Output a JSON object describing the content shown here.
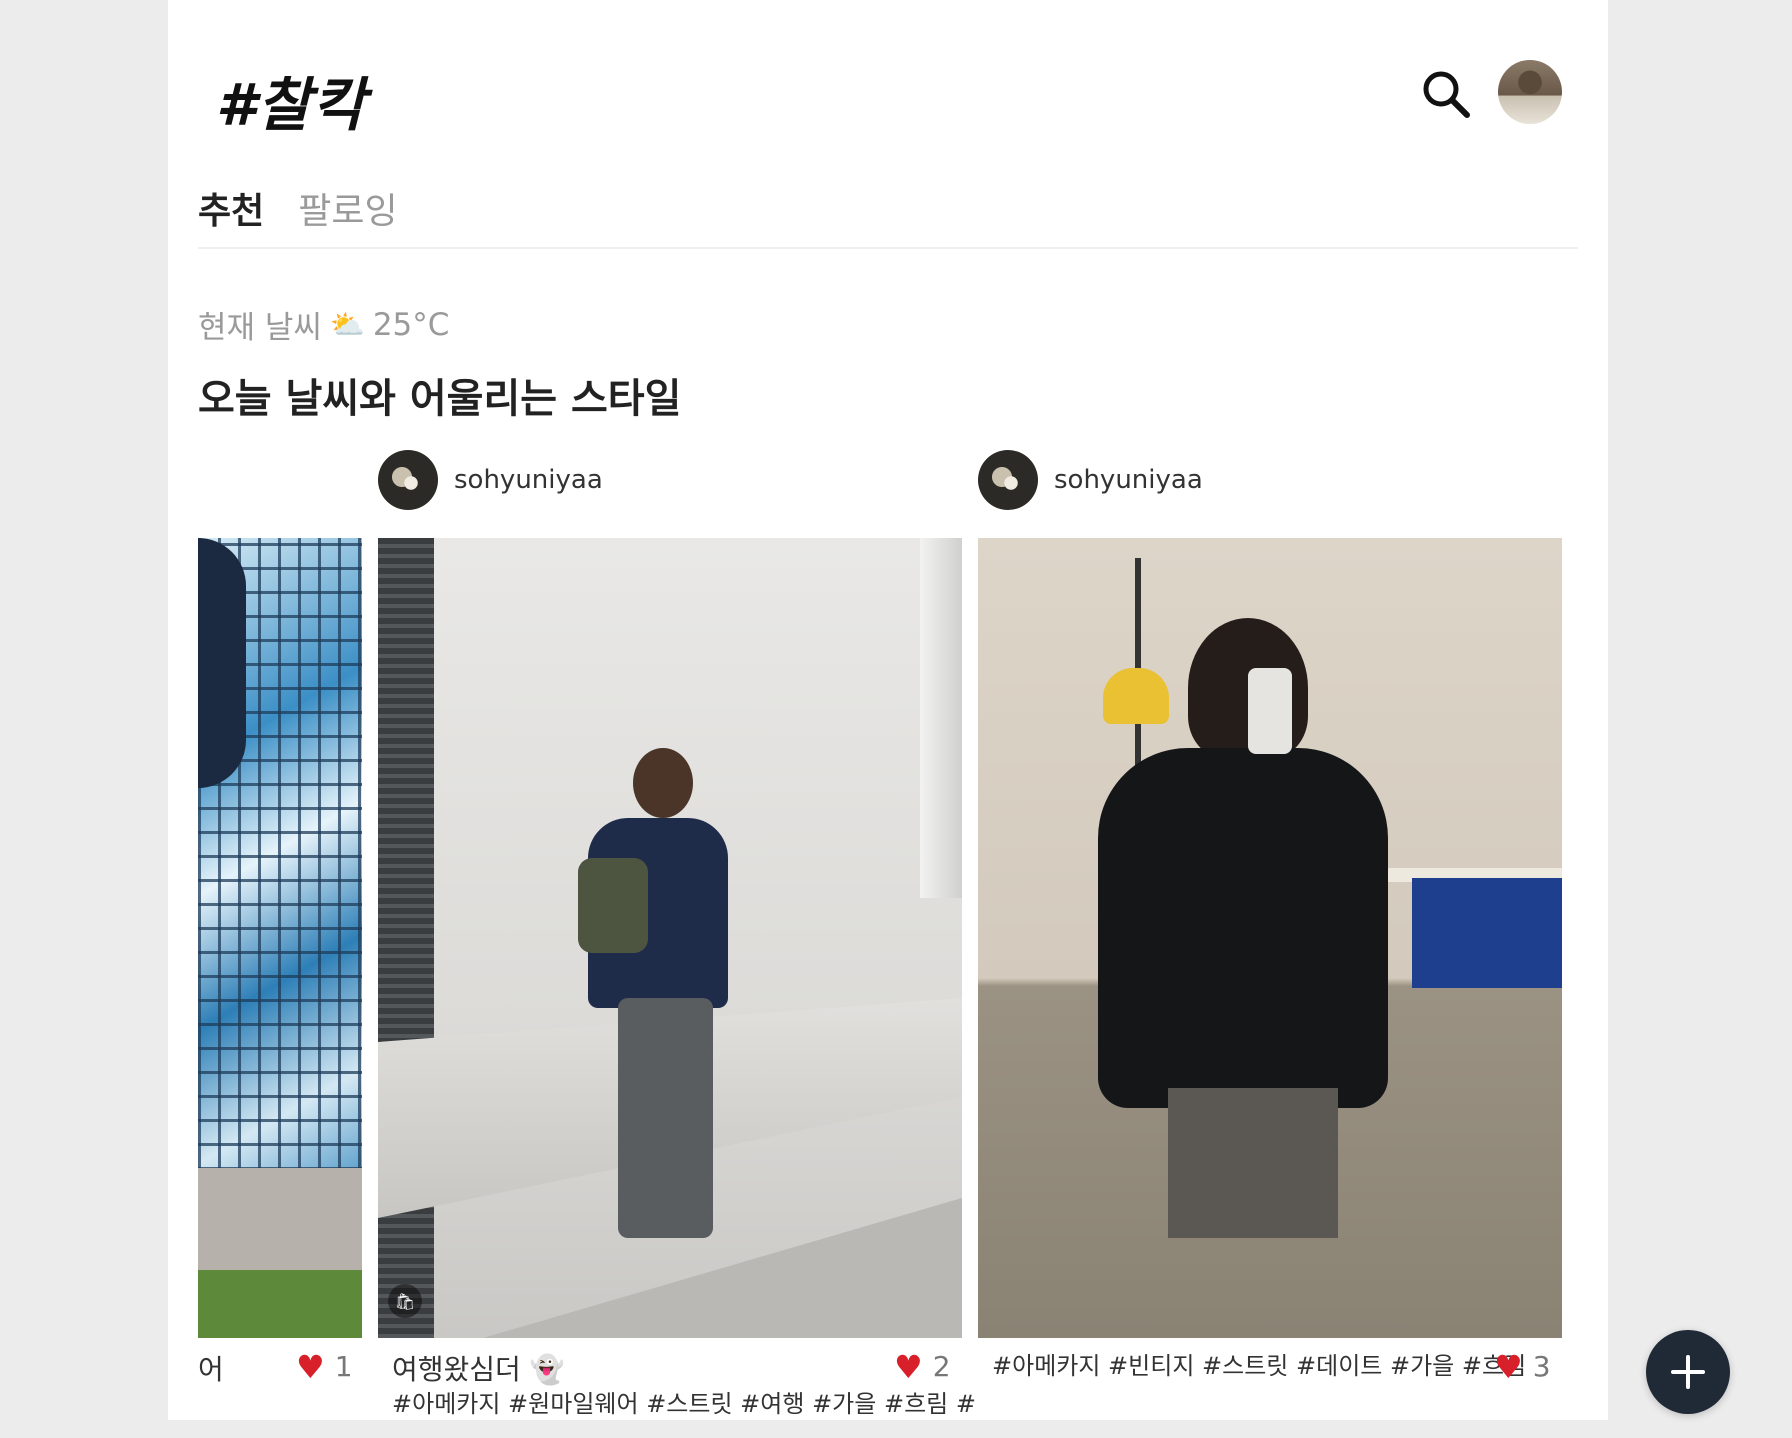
{
  "app": {
    "logo": "#찰칵"
  },
  "header": {
    "search_icon": "search-icon",
    "avatar": "profile-avatar"
  },
  "tabs": [
    {
      "label": "추천",
      "active": true
    },
    {
      "label": "팔로잉",
      "active": false
    }
  ],
  "weather": {
    "label": "현재 날씨",
    "icon": "⛅",
    "temperature": "25°C"
  },
  "section": {
    "title": "오늘 날씨와 어울리는 스타일"
  },
  "posts": [
    {
      "caption": "어",
      "likes": "1"
    },
    {
      "username": "sohyuniyaa",
      "caption": "여행왔심더 👻",
      "hashtags": "#아메카지 #원마일웨어 #스트릿 #여행 #가을 #흐림 #",
      "likes": "2"
    },
    {
      "username": "sohyuniyaa",
      "hashtags": "#아메카지 #빈티지 #스트릿 #데이트 #가을 #흐림",
      "likes": "3"
    }
  ],
  "colors": {
    "heart": "#d8202a",
    "fab": "#1f2a36",
    "muted": "#9a9a9a"
  },
  "fab": {
    "icon": "plus-icon"
  }
}
